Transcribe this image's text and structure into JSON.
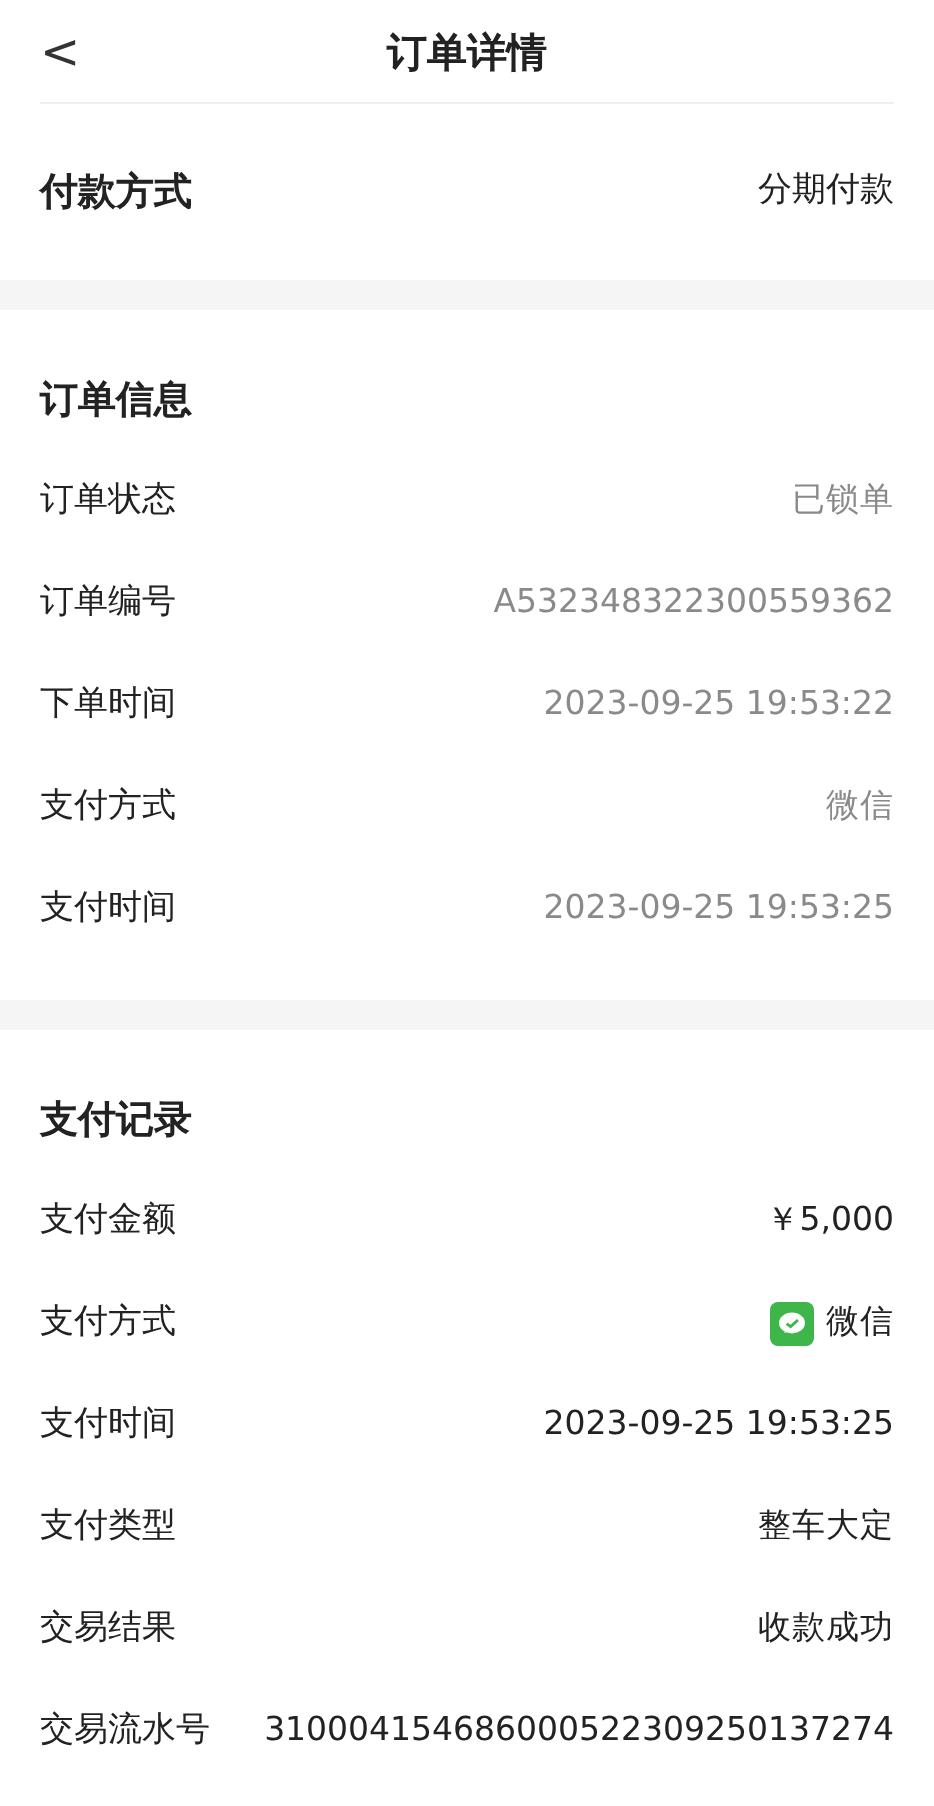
{
  "header": {
    "back": "<",
    "title": "订单详情"
  },
  "payment_method": {
    "label": "付款方式",
    "value": "分期付款"
  },
  "sections": [
    {
      "title": "订单信息",
      "values_muted": true,
      "rows": [
        {
          "kind": "text",
          "label": "订单状态",
          "value": "已锁单"
        },
        {
          "kind": "text",
          "label": "订单编号",
          "value": "A532348322300559362"
        },
        {
          "kind": "text",
          "label": "下单时间",
          "value": "2023-09-25 19:53:22"
        },
        {
          "kind": "text",
          "label": "支付方式",
          "value": "微信"
        },
        {
          "kind": "text",
          "label": "支付时间",
          "value": "2023-09-25 19:53:25"
        }
      ]
    },
    {
      "title": "支付记录",
      "values_muted": false,
      "rows": [
        {
          "kind": "text",
          "label": "支付金额",
          "value": "￥5,000"
        },
        {
          "kind": "wechat",
          "label": "支付方式",
          "value": "微信"
        },
        {
          "kind": "text",
          "label": "支付时间",
          "value": "2023-09-25 19:53:25"
        },
        {
          "kind": "text",
          "label": "支付类型",
          "value": "整车大定"
        },
        {
          "kind": "text",
          "label": "交易结果",
          "value": "收款成功"
        },
        {
          "kind": "text",
          "label": "交易流水号",
          "value": "310004154686000522309250137274"
        }
      ]
    }
  ]
}
